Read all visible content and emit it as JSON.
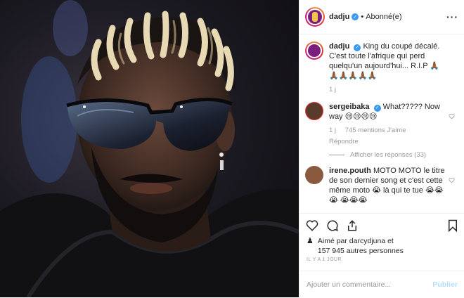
{
  "post": {
    "username": "dadju",
    "separator": "•",
    "follow_status": "Abonné(e)",
    "more_icon": "more-horizontal-icon"
  },
  "caption": {
    "username": "dadju",
    "text": "King du coupé décalé. C'est toute l'afrique qui perd quelqu'un aujourd'hui... R.I.P 🙏🏾🙏🏾🙏🏾🙏🏾🙏🏾🙏🏾",
    "time": "1 j"
  },
  "comments": [
    {
      "username": "sergeibaka",
      "text": "What????? Now way 😢😢😢😢",
      "time": "1 j",
      "likes": "745 mentions J'aime",
      "reply": "Répondre",
      "view_replies": "Afficher les réponses (33)"
    },
    {
      "username": "irene.pouth",
      "text": "MOTO MOTO le titre de son dernier song et c'est cette même moto 😭 là qui te tue 😭😭😭 😭😭😭"
    }
  ],
  "likes": {
    "line1": "Aimé par darcydjuna et",
    "line2": "157 945 autres personnes"
  },
  "timestamp": "IL Y A 1 JOUR",
  "composer": {
    "placeholder": "Ajouter un commentaire...",
    "publish": "Publier"
  },
  "colors": {
    "verified": "#3897f0",
    "muted": "#999999",
    "publish_disabled": "#b2dffc"
  }
}
